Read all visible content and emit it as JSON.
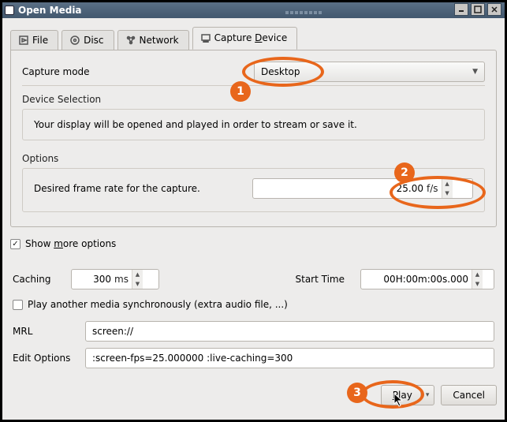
{
  "window": {
    "title": "Open Media"
  },
  "tabs": {
    "file": "File",
    "disc": "Disc",
    "network": "Network",
    "capture": "Capture Device"
  },
  "capture": {
    "mode_label": "Capture mode",
    "mode_value": "Desktop",
    "device_section": "Device Selection",
    "device_msg": "Your display will be opened and played in order to stream or save it.",
    "options_section": "Options",
    "frame_label": "Desired frame rate for the capture.",
    "frame_value": "25.00",
    "frame_suffix": "f/s"
  },
  "more": {
    "show_more": "Show more options",
    "caching_label": "Caching",
    "caching_value": "300",
    "caching_suffix": "ms",
    "start_label": "Start Time",
    "start_value": "00H:00m:00s.000",
    "sync_label": "Play another media synchronously (extra audio file, ...)",
    "mrl_label": "MRL",
    "mrl_value": "screen://",
    "edit_label": "Edit Options",
    "edit_value": ":screen-fps=25.000000 :live-caching=300"
  },
  "buttons": {
    "play": "Play",
    "cancel": "Cancel"
  },
  "callouts": {
    "one": "1",
    "two": "2",
    "three": "3"
  },
  "chart_data": null
}
